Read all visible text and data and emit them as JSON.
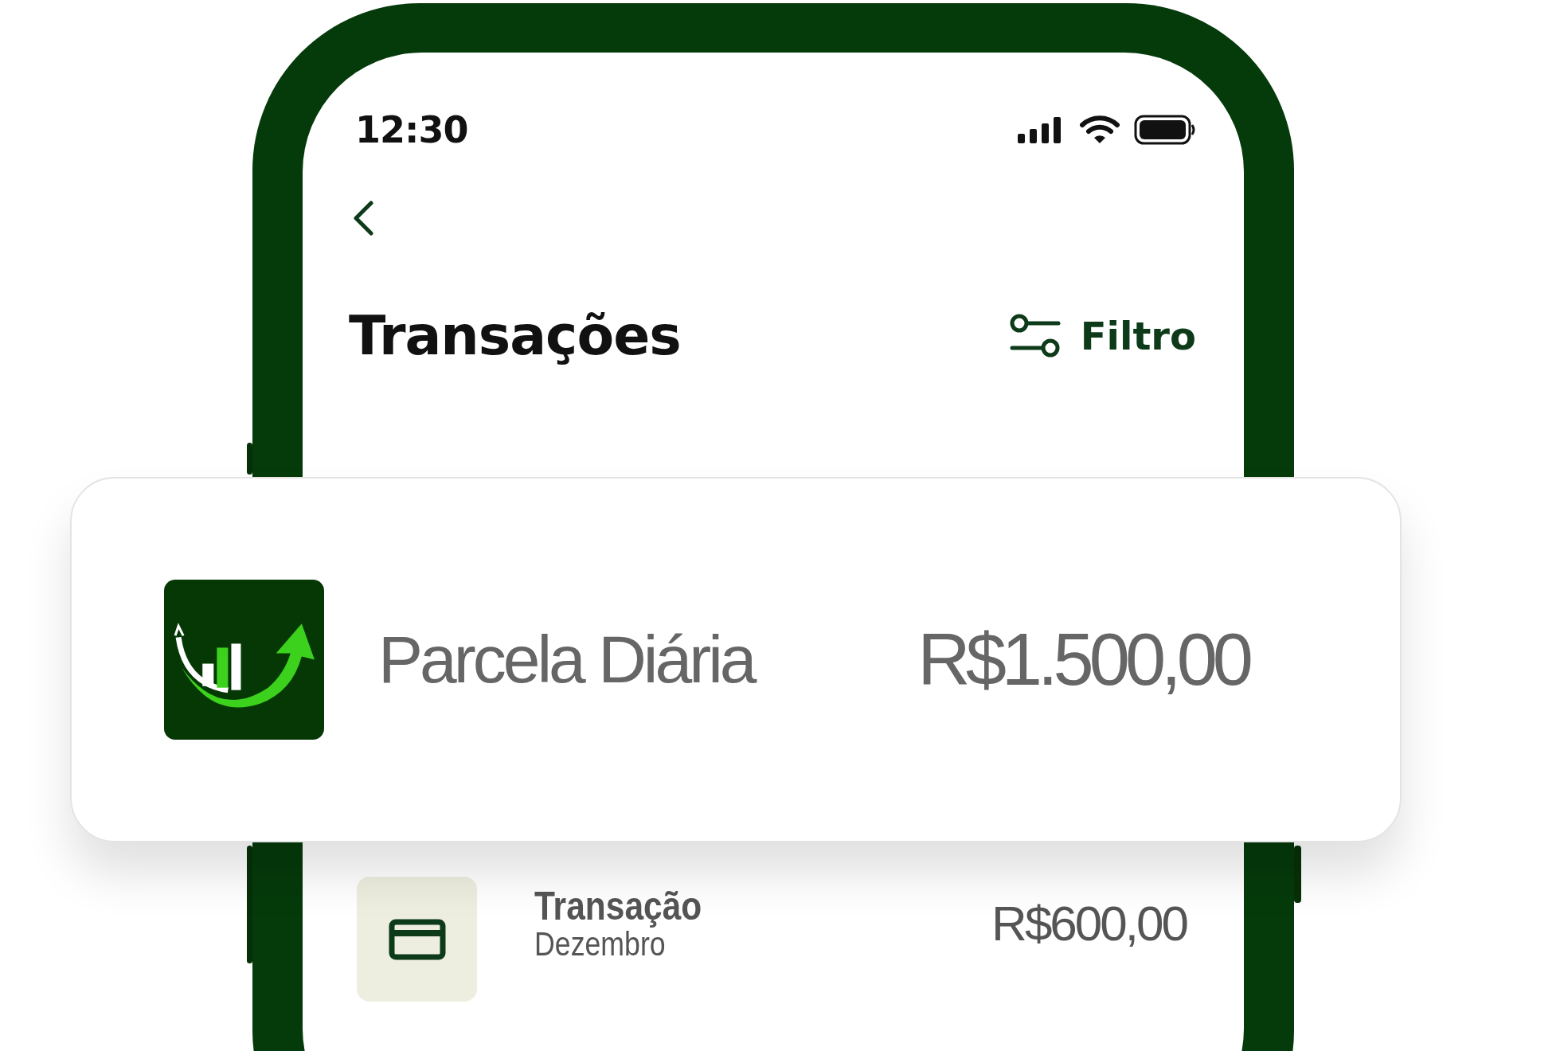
{
  "status_bar": {
    "time": "12:30"
  },
  "header": {
    "title": "Transações",
    "filter_label": "Filtro"
  },
  "featured_transaction": {
    "name": "Parcela Diária",
    "amount": "R$1.500,00"
  },
  "transactions": [
    {
      "title": "Transação",
      "subtitle": "Dezembro",
      "amount": "R$600,00"
    }
  ]
}
